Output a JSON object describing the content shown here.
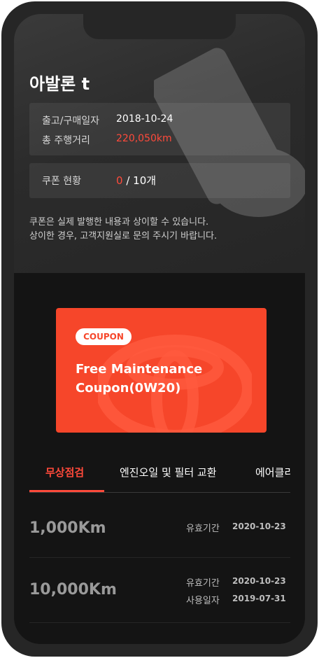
{
  "car": {
    "name": "아발론 t",
    "rows": [
      {
        "label": "출고/구매일자",
        "value": "2018-10-24"
      },
      {
        "label": "총 주행거리",
        "value": "220,050km"
      }
    ]
  },
  "coupon_status": {
    "label": "쿠폰 현황",
    "used": "0",
    "total": "/ 10개"
  },
  "notice": {
    "line1": "쿠폰은 실제 발행한 내용과 상이할 수 있습니다.",
    "line2": "상이한 경우, 고객지원실로 문의 주시기 바랍니다."
  },
  "coupon_card": {
    "tag": "COUPON",
    "title_line1": "Free Maintenance",
    "title_line2": "Coupon(0W20)"
  },
  "tabs": [
    {
      "label": "무상점검",
      "active": true
    },
    {
      "label": "엔진오일 및 필터 교환",
      "active": false
    },
    {
      "label": "에어클리",
      "active": false
    }
  ],
  "items": [
    {
      "km": "1,000Km",
      "meta": [
        {
          "label": "유효기간",
          "value": "2020-10-23"
        }
      ]
    },
    {
      "km": "10,000Km",
      "meta": [
        {
          "label": "유효기간",
          "value": "2020-10-23"
        },
        {
          "label": "사용일자",
          "value": "2019-07-31"
        }
      ]
    }
  ],
  "colors": {
    "accent": "#ff4a3b",
    "card": "#f6462a",
    "background": "#141414"
  }
}
